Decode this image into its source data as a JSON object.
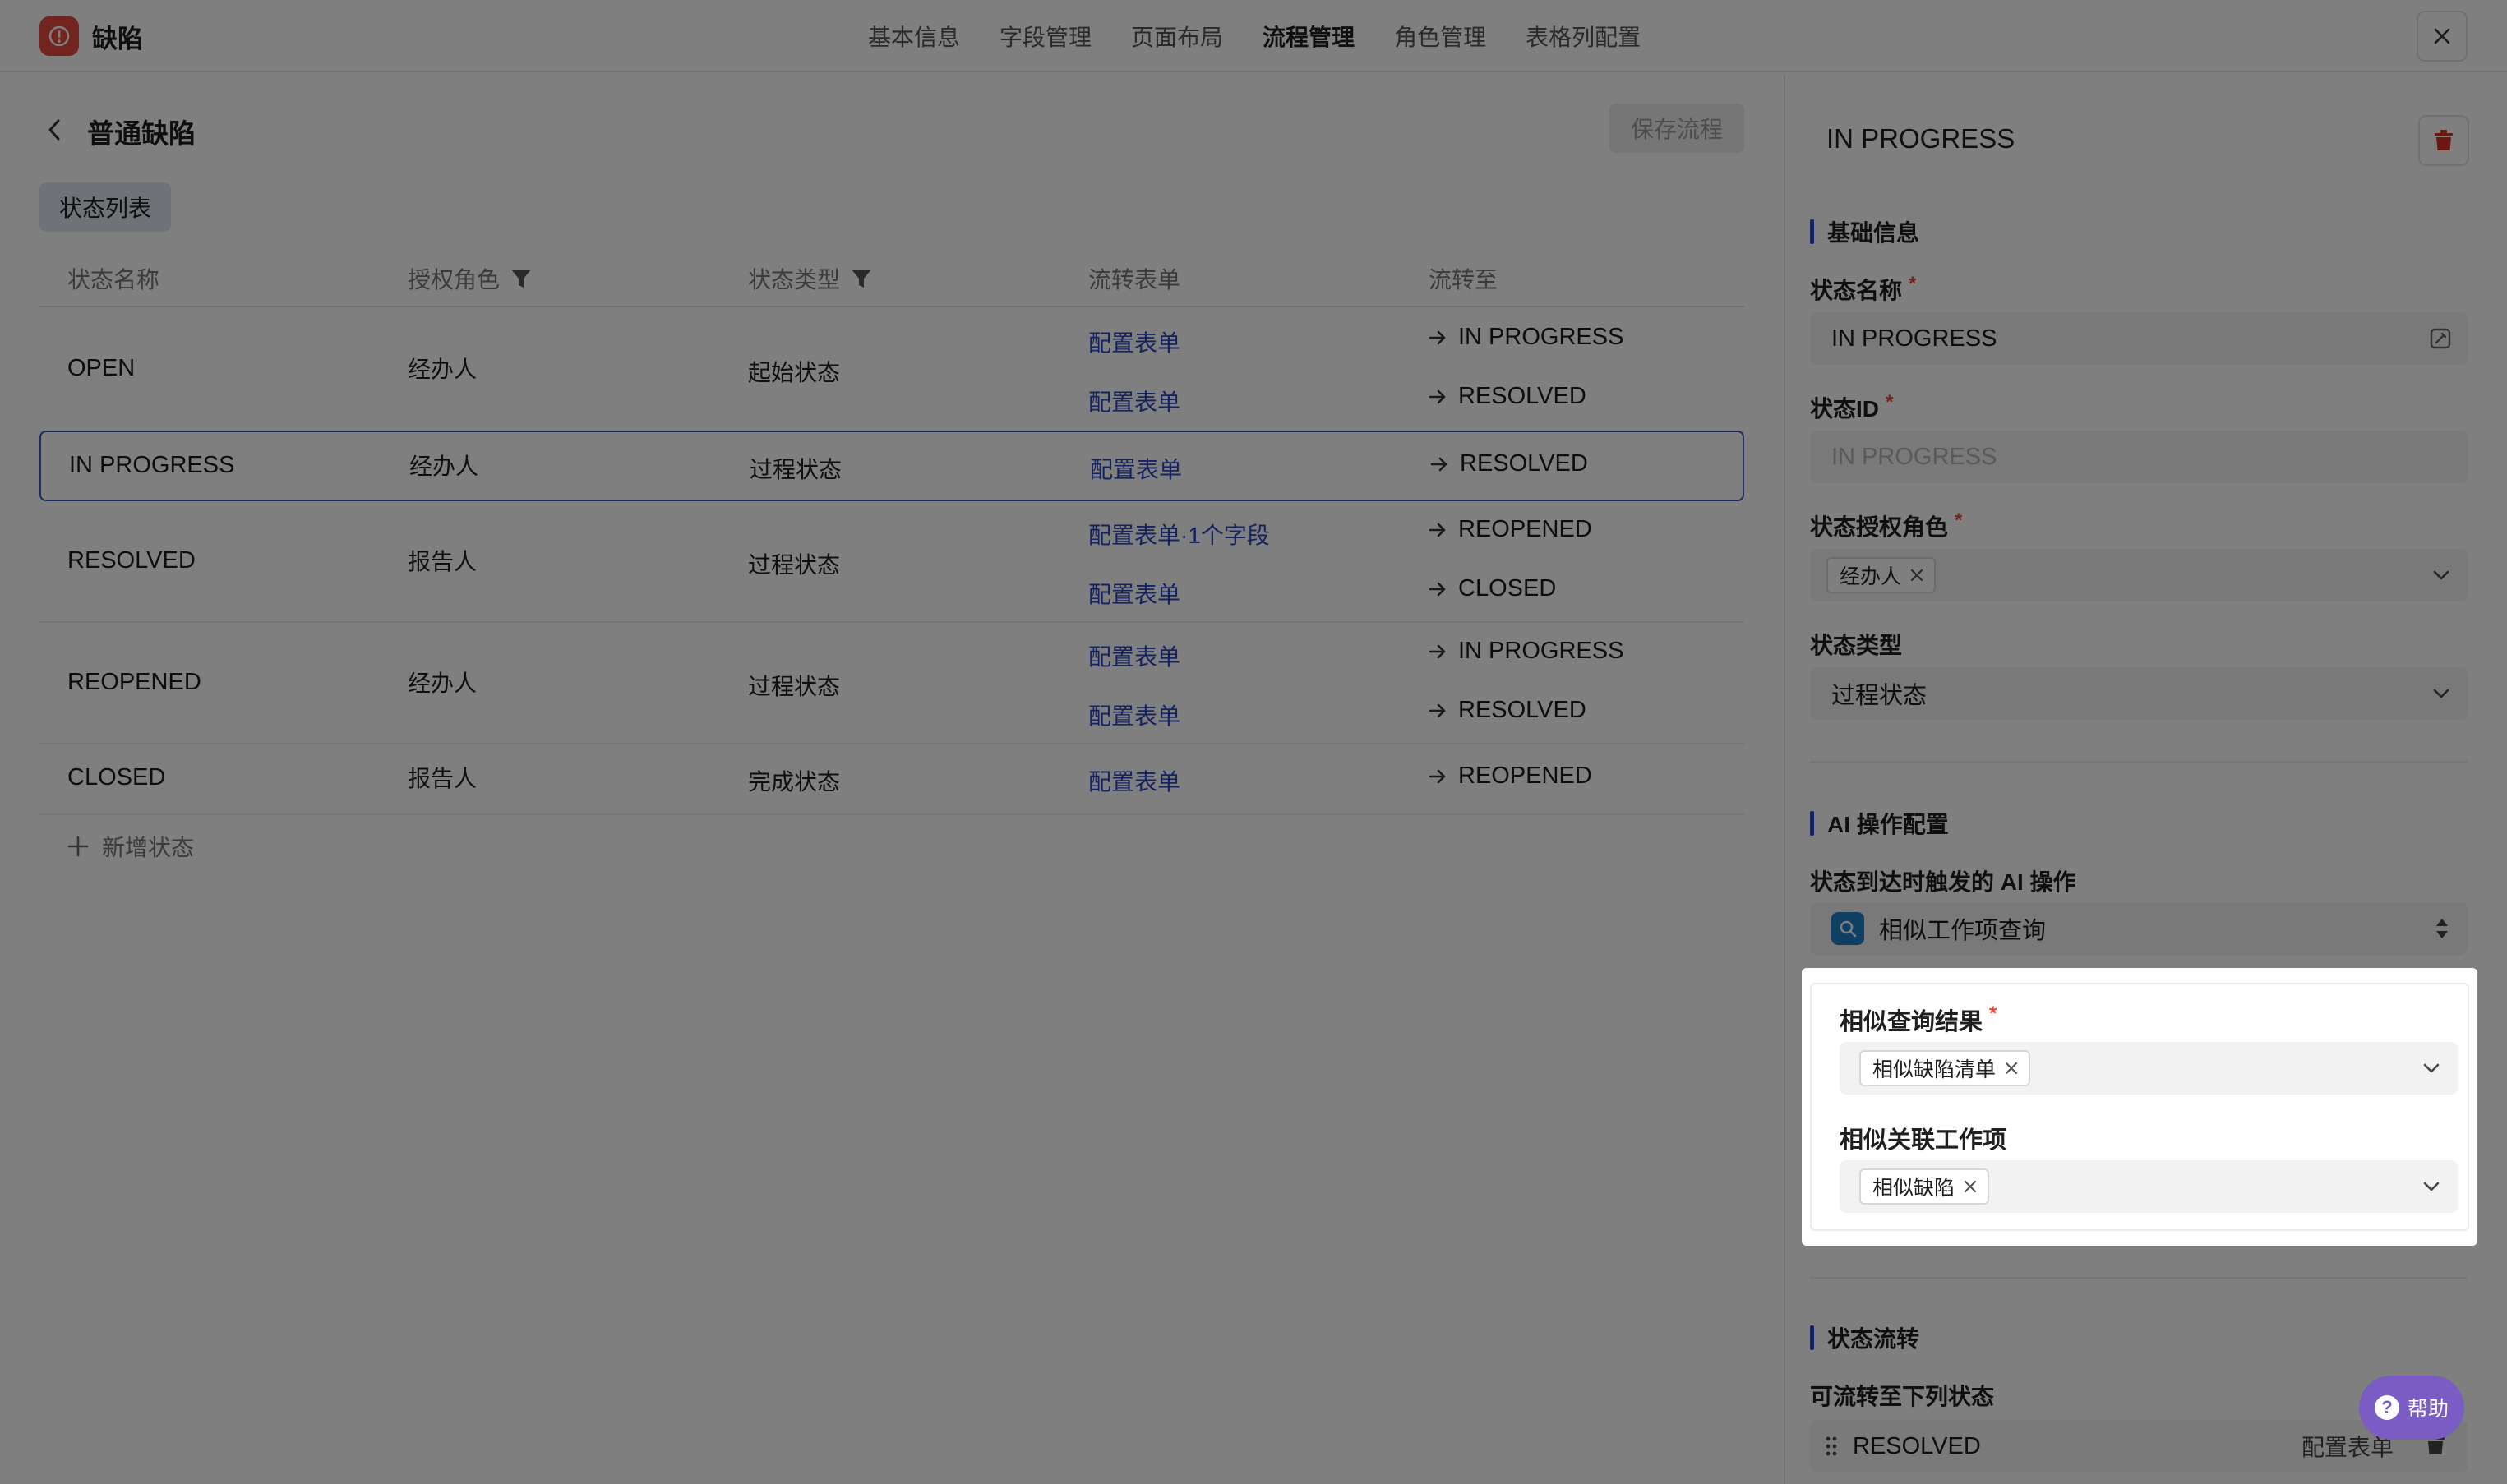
{
  "app": {
    "title": "缺陷"
  },
  "nav": {
    "items": [
      {
        "label": "基本信息"
      },
      {
        "label": "字段管理"
      },
      {
        "label": "页面布局"
      },
      {
        "label": "流程管理",
        "active": true
      },
      {
        "label": "角色管理"
      },
      {
        "label": "表格列配置"
      }
    ]
  },
  "main": {
    "title": "普通缺陷",
    "save_label": "保存流程",
    "tab_label": "状态列表",
    "columns": [
      "状态名称",
      "授权角色",
      "状态类型",
      "流转表单",
      "流转至"
    ],
    "rows": [
      {
        "name": "OPEN",
        "role": "经办人",
        "type": "起始状态",
        "transitions": [
          {
            "form": "配置表单",
            "to": "IN PROGRESS"
          },
          {
            "form": "配置表单",
            "to": "RESOLVED"
          }
        ]
      },
      {
        "name": "IN PROGRESS",
        "role": "经办人",
        "type": "过程状态",
        "selected": true,
        "transitions": [
          {
            "form": "配置表单",
            "to": "RESOLVED"
          }
        ]
      },
      {
        "name": "RESOLVED",
        "role": "报告人",
        "type": "过程状态",
        "transitions": [
          {
            "form": "配置表单·1个字段",
            "to": "REOPENED"
          },
          {
            "form": "配置表单",
            "to": "CLOSED"
          }
        ]
      },
      {
        "name": "REOPENED",
        "role": "经办人",
        "type": "过程状态",
        "transitions": [
          {
            "form": "配置表单",
            "to": "IN PROGRESS"
          },
          {
            "form": "配置表单",
            "to": "RESOLVED"
          }
        ]
      },
      {
        "name": "CLOSED",
        "role": "报告人",
        "type": "完成状态",
        "transitions": [
          {
            "form": "配置表单",
            "to": "REOPENED"
          }
        ]
      }
    ],
    "add_label": "新增状态"
  },
  "panel": {
    "title": "IN PROGRESS",
    "basic_section": "基础信息",
    "name_label": "状态名称",
    "name_value": "IN PROGRESS",
    "id_label": "状态ID",
    "id_value": "IN PROGRESS",
    "role_label": "状态授权角色",
    "role_tag": "经办人",
    "type_label": "状态类型",
    "type_value": "过程状态",
    "ai_section": "AI 操作配置",
    "ai_trigger_label": "状态到达时触发的 AI 操作",
    "ai_trigger_value": "相似工作项查询",
    "similar_result_label": "相似查询结果",
    "similar_result_tag": "相似缺陷清单",
    "similar_item_label": "相似关联工作项",
    "similar_item_tag": "相似缺陷",
    "flow_section": "状态流转",
    "flow_label": "可流转至下列状态",
    "flow_row": {
      "to": "RESOLVED",
      "form": "配置表单"
    }
  },
  "help": {
    "label": "帮助"
  },
  "colors": {
    "accent": "#2b47c6",
    "brand": "#e5483c",
    "danger": "#d93025",
    "help": "#7a5cc4"
  }
}
